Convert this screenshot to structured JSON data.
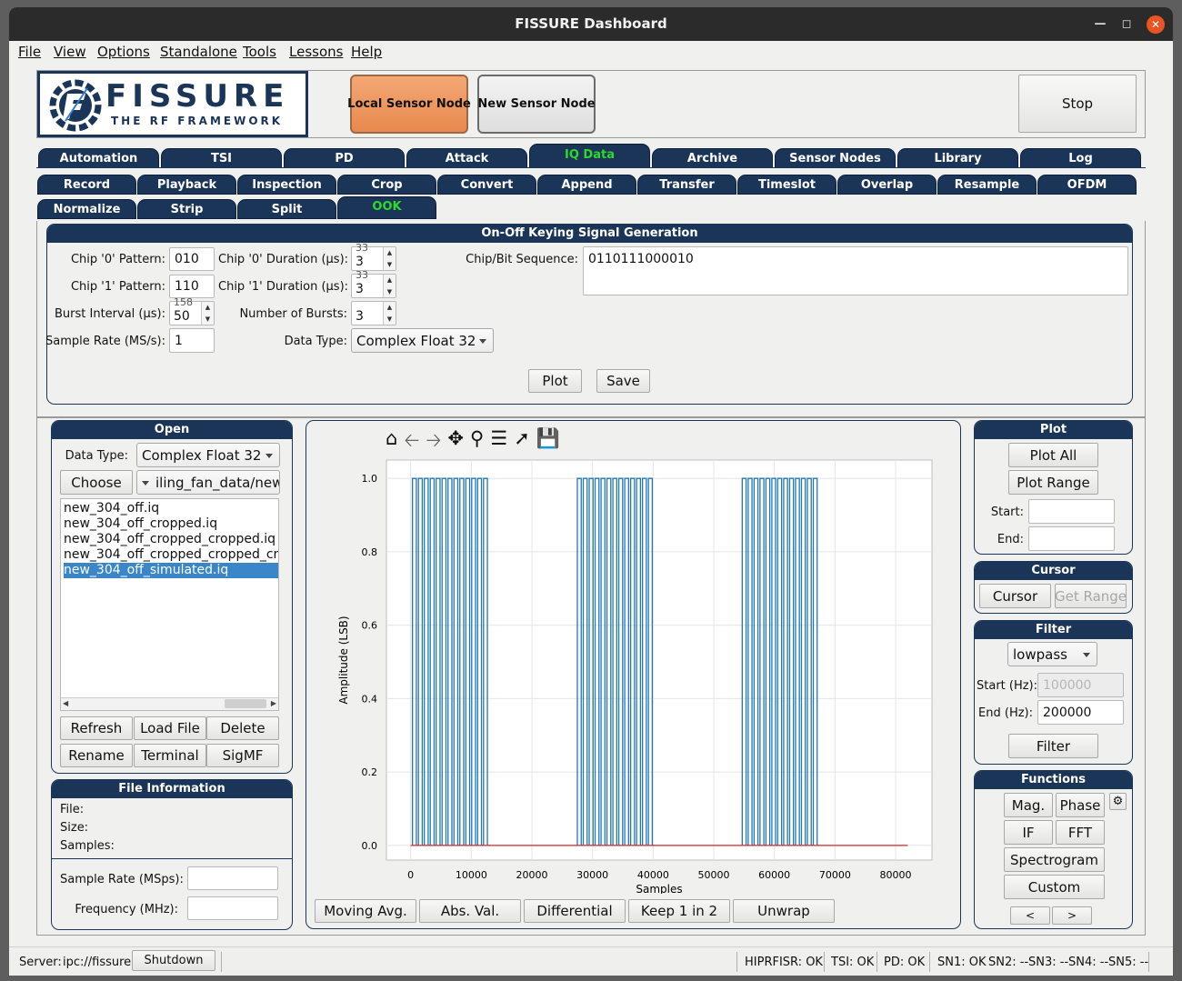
{
  "window": {
    "title": "FISSURE Dashboard"
  },
  "menu": [
    "File",
    "View",
    "Options",
    "Standalone",
    "Tools",
    "Lessons",
    "Help"
  ],
  "logo": {
    "name": "FISSURE",
    "tagline": "THE RF FRAMEWORK"
  },
  "header": {
    "local_sensor": "Local Sensor Node",
    "new_sensor": "New Sensor Node",
    "stop": "Stop"
  },
  "tabs": [
    "Automation",
    "TSI",
    "PD",
    "Attack",
    "IQ Data",
    "Archive",
    "Sensor Nodes",
    "Library",
    "Log"
  ],
  "subtabs_row1": [
    "Record",
    "Playback",
    "Inspection",
    "Crop",
    "Convert",
    "Append",
    "Transfer",
    "Timeslot",
    "Overlap",
    "Resample",
    "OFDM"
  ],
  "subtabs_row2": [
    "Normalize",
    "Strip",
    "Split",
    "OOK"
  ],
  "ook": {
    "title": "On-Off Keying Signal Generation",
    "chip0_label": "Chip '0' Pattern:",
    "chip0_value": "010",
    "chip1_label": "Chip '1' Pattern:",
    "chip1_value": "110",
    "burst_interval_label": "Burst Interval (µs):",
    "burst_interval_value": "50",
    "burst_interval_ghost": "158",
    "sample_rate_label": "Sample Rate (MS/s):",
    "sample_rate_value": "1",
    "chip0_dur_label": "Chip '0' Duration (µs):",
    "chip0_dur_value": "3",
    "chip0_dur_ghost": "33",
    "chip1_dur_label": "Chip '1' Duration (µs):",
    "chip1_dur_value": "3",
    "chip1_dur_ghost": "33",
    "bursts_label": "Number of Bursts:",
    "bursts_value": "3",
    "data_type_label": "Data Type:",
    "data_type_value": "Complex Float 32",
    "sequence_label": "Chip/Bit Sequence:",
    "sequence_value": "0110111000010",
    "plot": "Plot",
    "save": "Save"
  },
  "open": {
    "title": "Open",
    "data_type_label": "Data Type:",
    "data_type_value": "Complex Float 32",
    "choose": "Choose",
    "folder": "iling_fan_data/new",
    "files": [
      "new_304_off.iq",
      "new_304_off_cropped.iq",
      "new_304_off_cropped_cropped.iq",
      "new_304_off_cropped_cropped_cr",
      "new_304_off_simulated.iq"
    ],
    "selected_index": 4,
    "refresh": "Refresh",
    "load_file": "Load File",
    "delete": "Delete",
    "rename": "Rename",
    "terminal": "Terminal",
    "sigmf": "SigMF"
  },
  "file_info": {
    "title": "File Information",
    "file": "File:",
    "size": "Size:",
    "samples": "Samples:",
    "sample_rate": "Sample Rate (MSps):",
    "frequency": "Frequency (MHz):"
  },
  "chart_data": {
    "type": "line",
    "xlabel": "Samples",
    "ylabel": "Amplitude (LSB)",
    "xlim": [
      -4000,
      86000
    ],
    "ylim": [
      -0.04,
      1.05
    ],
    "xticks": [
      0,
      10000,
      20000,
      30000,
      40000,
      50000,
      60000,
      70000,
      80000
    ],
    "yticks": [
      0.0,
      0.2,
      0.4,
      0.6,
      0.8,
      1.0
    ],
    "grid": true,
    "bursts": [
      {
        "start": 300,
        "end": 13000
      },
      {
        "start": 27500,
        "end": 40200
      },
      {
        "start": 54700,
        "end": 67400
      }
    ],
    "pulses_per_burst": 13,
    "high": 1.0,
    "low": 0.0,
    "baseline": {
      "x": [
        0,
        82000
      ],
      "y": [
        0,
        0
      ]
    },
    "series_colors": {
      "signal": "#1f77b4",
      "baseline": "#d62728"
    }
  },
  "plot_buttons": [
    "Moving Avg.",
    "Abs. Val.",
    "Differential",
    "Keep 1 in 2",
    "Unwrap"
  ],
  "plot_panel": {
    "title": "Plot",
    "plot_all": "Plot All",
    "plot_range": "Plot Range",
    "start": "Start:",
    "end": "End:"
  },
  "cursor_panel": {
    "title": "Cursor",
    "cursor": "Cursor",
    "get_range": "Get Range"
  },
  "filter_panel": {
    "title": "Filter",
    "type": "lowpass",
    "start_label": "Start (Hz):",
    "start_value": "100000",
    "end_label": "End (Hz):",
    "end_value": "200000",
    "filter": "Filter"
  },
  "functions_panel": {
    "title": "Functions",
    "mag": "Mag.",
    "phase": "Phase",
    "if": "IF",
    "fft": "FFT",
    "spectrogram": "Spectrogram",
    "custom": "Custom",
    "prev": "<",
    "next": ">"
  },
  "status": {
    "server_label": "Server:",
    "server_value": "ipc://fissure",
    "shutdown": "Shutdown",
    "hiprfisr": "HIPRFISR: OK",
    "tsi": "TSI: OK",
    "pd": "PD: OK",
    "sn1": "SN1: OK",
    "sn2": "SN2: --",
    "sn3": "SN3: --",
    "sn4": "SN4: --",
    "sn5": "SN5: --"
  }
}
